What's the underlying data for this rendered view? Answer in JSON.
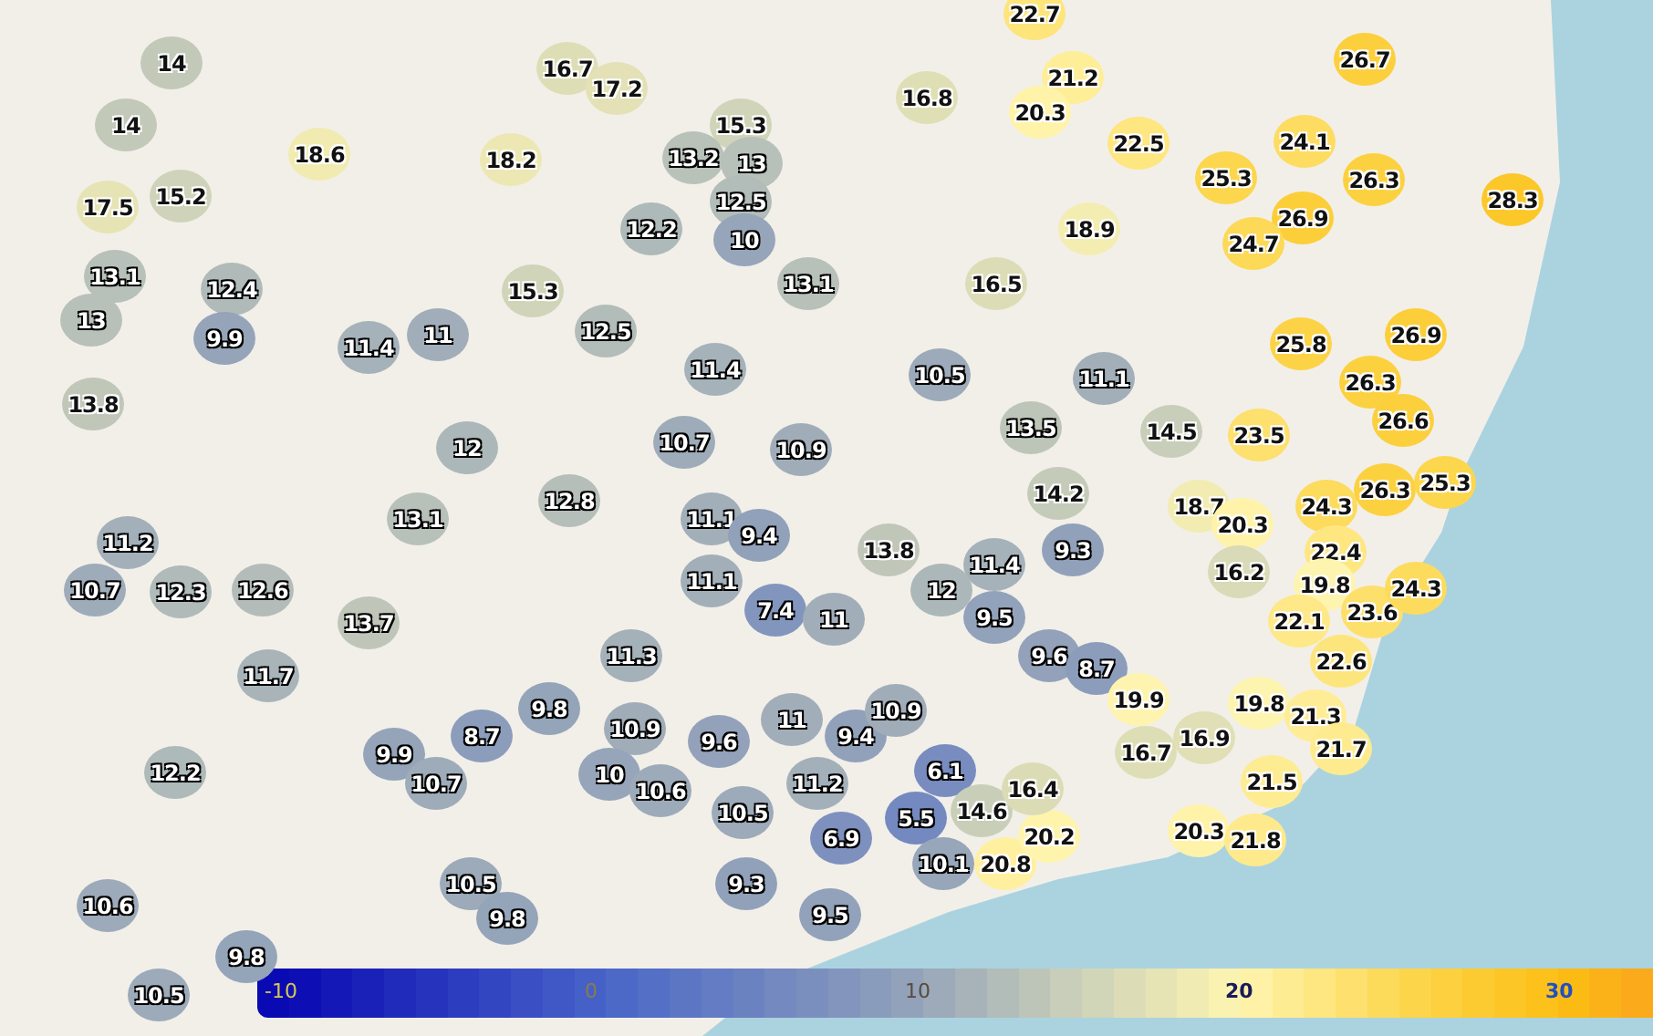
{
  "markers": [
    "14",
    "14",
    "18.6",
    "17.5",
    "15.2",
    "13.1",
    "13",
    "12.4",
    "9.9",
    "11.4",
    "11",
    "13.8",
    "12",
    "18.2",
    "15.3",
    "16.7",
    "17.2",
    "15.3",
    "13.2",
    "13",
    "12.5",
    "10",
    "12.2",
    "13.1",
    "12.5",
    "11.4",
    "10.7",
    "10.9",
    "16.8",
    "22.7",
    "21.2",
    "20.3",
    "18.9",
    "16.5",
    "10.5",
    "13.5",
    "14.2",
    "11.1",
    "22.5",
    "26.7",
    "24.1",
    "25.3",
    "26.3",
    "26.9",
    "24.7",
    "28.3",
    "25.8",
    "26.9",
    "26.3",
    "26.6",
    "14.5",
    "23.5",
    "18.7",
    "20.3",
    "24.3",
    "26.3",
    "25.3",
    "12.8",
    "13.1",
    "11.2",
    "10.7",
    "12.3",
    "12.6",
    "13.7",
    "11.7",
    "12.2",
    "9.9",
    "10.7",
    "8.7",
    "9.8",
    "10.6",
    "9.8",
    "10.5",
    "10.5",
    "9.8",
    "11.1",
    "9.4",
    "13.8",
    "11.4",
    "9.3",
    "11.1",
    "7.4",
    "11",
    "12",
    "9.5",
    "11.3",
    "9.6",
    "8.7",
    "10.9",
    "9.6",
    "11",
    "9.4",
    "10.9",
    "10",
    "10.6",
    "10.5",
    "11.2",
    "6.1",
    "6.9",
    "5.5",
    "14.6",
    "10.1",
    "20.8",
    "20.2",
    "16.4",
    "9.3",
    "9.5",
    "19.9",
    "16.2",
    "22.4",
    "19.8",
    "23.6",
    "24.3",
    "22.1",
    "22.6",
    "19.8",
    "21.3",
    "21.7",
    "16.9",
    "16.7",
    "21.5",
    "20.3",
    "21.8"
  ],
  "legend": {
    "ticks": [
      "-10",
      "0",
      "10",
      "20",
      "30"
    ]
  }
}
